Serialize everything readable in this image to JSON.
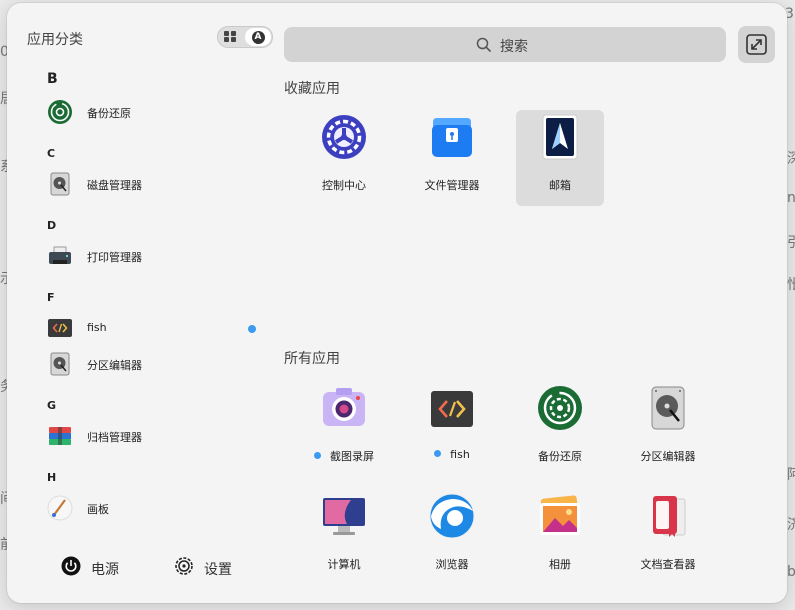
{
  "background_window": {
    "fragments": [
      "3",
      "0",
      "居",
      "系",
      "示",
      "务",
      "间",
      "前",
      "深",
      "nu",
      "引",
      "怅",
      "阿",
      "济",
      "b"
    ]
  },
  "launcher": {
    "category_title": "应用分类",
    "view_toggle": {
      "grid_icon": "grid-icon",
      "alpha_icon": "letter-a-icon",
      "alpha_char": "A",
      "active": "alphabetical"
    },
    "search": {
      "placeholder": "搜索",
      "icon": "search-icon"
    },
    "expand_icon": "expand-icon",
    "sidebar": {
      "groups": [
        {
          "letter": "B",
          "items": [
            {
              "label": "备份还原",
              "icon": "backup-restore-icon"
            }
          ]
        },
        {
          "letter": "C",
          "items": [
            {
              "label": "磁盘管理器",
              "icon": "disk-manager-icon"
            }
          ]
        },
        {
          "letter": "D",
          "items": [
            {
              "label": "打印管理器",
              "icon": "printer-icon"
            }
          ]
        },
        {
          "letter": "F",
          "items": [
            {
              "label": "fish",
              "icon": "terminal-icon"
            },
            {
              "label": "分区编辑器",
              "icon": "partition-editor-icon"
            }
          ]
        },
        {
          "letter": "G",
          "items": [
            {
              "label": "归档管理器",
              "icon": "archive-manager-icon"
            }
          ]
        },
        {
          "letter": "H",
          "items": [
            {
              "label": "画板",
              "icon": "drawing-board-icon"
            }
          ]
        }
      ]
    },
    "bottom": {
      "power": {
        "label": "电源",
        "icon": "power-icon"
      },
      "settings": {
        "label": "设置",
        "icon": "settings-icon"
      }
    },
    "favorites": {
      "title": "收藏应用",
      "apps": [
        {
          "label": "控制中心",
          "icon": "control-center-icon",
          "selected": false
        },
        {
          "label": "文件管理器",
          "icon": "file-manager-icon",
          "selected": false
        },
        {
          "label": "邮箱",
          "icon": "mail-icon",
          "selected": true
        }
      ]
    },
    "all_apps": {
      "title": "所有应用",
      "apps": [
        {
          "label": "截图录屏",
          "icon": "screenshot-icon",
          "new": true
        },
        {
          "label": "fish",
          "icon": "terminal-icon",
          "new": true
        },
        {
          "label": "备份还原",
          "icon": "backup-restore-icon",
          "new": false
        },
        {
          "label": "分区编辑器",
          "icon": "partition-editor-icon",
          "new": false
        },
        {
          "label": "计算机",
          "icon": "computer-icon",
          "new": false
        },
        {
          "label": "浏览器",
          "icon": "browser-icon",
          "new": false
        },
        {
          "label": "相册",
          "icon": "photo-album-icon",
          "new": false
        },
        {
          "label": "文档查看器",
          "icon": "document-viewer-icon",
          "new": false
        }
      ]
    },
    "colors": {
      "accent": "#3a9bf0",
      "panel": "#f4f4f4",
      "search_bg": "#d3d3d3"
    }
  }
}
